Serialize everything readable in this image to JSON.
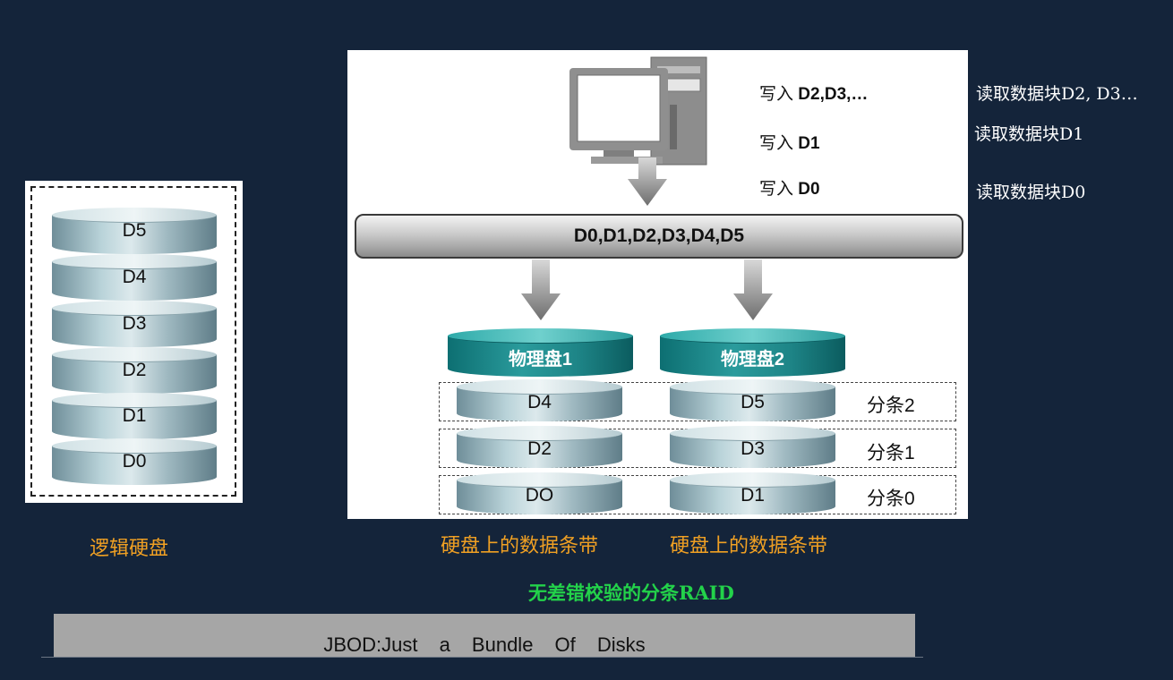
{
  "logical": {
    "disks": [
      "D5",
      "D4",
      "D3",
      "D2",
      "D1",
      "D0"
    ],
    "label": "逻辑硬盘"
  },
  "writes": [
    {
      "prefix": "写入",
      "block": "D2,D3,…"
    },
    {
      "prefix": "写入",
      "block": "D1"
    },
    {
      "prefix": "写入",
      "block": "D0"
    }
  ],
  "reads": [
    "读取数据块D2, D3…",
    "读取数据块D1",
    "读取数据块D0"
  ],
  "bus_label": "D0,D1,D2,D3,D4,D5",
  "physical": [
    {
      "name": "物理盘1",
      "blocks": [
        "D4",
        "D2",
        "DO"
      ],
      "stripe_label": "硬盘上的数据条带"
    },
    {
      "name": "物理盘2",
      "blocks": [
        "D5",
        "D3",
        "D1"
      ],
      "stripe_label": "硬盘上的数据条带"
    }
  ],
  "stripes": [
    "分条2",
    "分条1",
    "分条0"
  ],
  "caption": "无差错校验的分条RAID",
  "footer": "JBOD:Just a Bundle Of Disks",
  "colors": {
    "background": "#14243a",
    "highlight": "#f0a023",
    "caption": "#23d24a",
    "physical_disk": "#1e8587"
  }
}
